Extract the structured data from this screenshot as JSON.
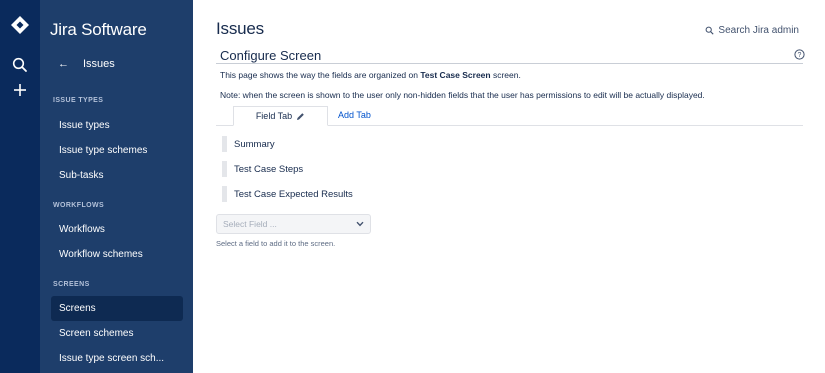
{
  "rail": {
    "logo_icon": "jira-logo-icon",
    "search_icon": "search-icon",
    "create_icon": "plus-icon"
  },
  "sidebar": {
    "title": "Jira Software",
    "back_label": "Issues",
    "sections": [
      {
        "heading": "ISSUE TYPES",
        "items": [
          "Issue types",
          "Issue type schemes",
          "Sub-tasks"
        ]
      },
      {
        "heading": "WORKFLOWS",
        "items": [
          "Workflows",
          "Workflow schemes"
        ]
      },
      {
        "heading": "SCREENS",
        "items": [
          "Screens",
          "Screen schemes",
          "Issue type screen sch..."
        ]
      }
    ],
    "active_item": "Screens"
  },
  "header": {
    "title": "Issues",
    "admin_search": "Search Jira admin"
  },
  "configure": {
    "title": "Configure Screen",
    "desc_prefix": "This page shows the way the fields are organized on ",
    "screen_name": "Test Case Screen",
    "desc_suffix": " screen.",
    "note": "Note: when the screen is shown to the user only non-hidden fields that the user has permissions to edit will be actually displayed.",
    "tabs": {
      "field_tab": "Field Tab",
      "add_tab": "Add Tab"
    },
    "fields": [
      "Summary",
      "Test Case Steps",
      "Test Case Expected Results"
    ],
    "select": {
      "placeholder": "Select Field ...",
      "hint": "Select a field to add it to the screen."
    }
  },
  "colors": {
    "rail": "#0a2a5c",
    "sidebar": "#1e3e6b",
    "sidebar_active": "#0e2a52",
    "link": "#0052cc",
    "text": "#172b4d"
  }
}
